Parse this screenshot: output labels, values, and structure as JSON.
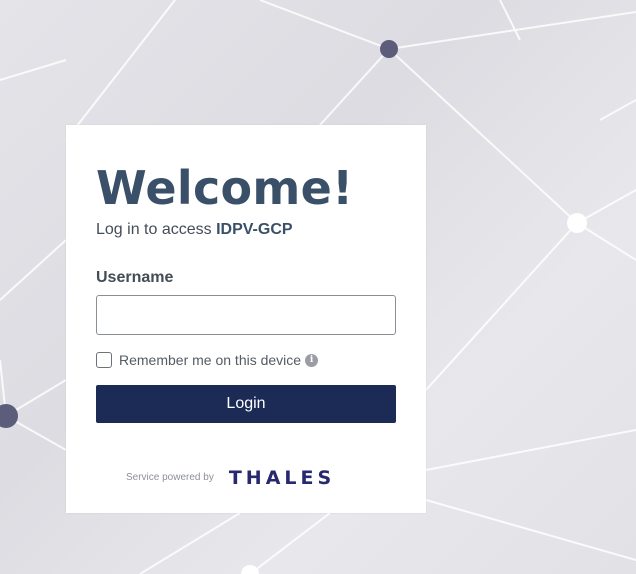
{
  "login": {
    "title": "Welcome!",
    "subtitle_prefix": "Log in to access",
    "app_name": "IDPV-GCP",
    "username_label": "Username",
    "username_value": "",
    "username_placeholder": "",
    "remember_label": "Remember me on this device",
    "remember_checked": false,
    "info_icon": "info-icon",
    "login_button": "Login"
  },
  "footer": {
    "powered_by": "Service powered by",
    "brand": "THALES"
  },
  "colors": {
    "title": "#3a5068",
    "button": "#1c2b56",
    "brand": "#27286e",
    "background": "#e2e2e7"
  }
}
